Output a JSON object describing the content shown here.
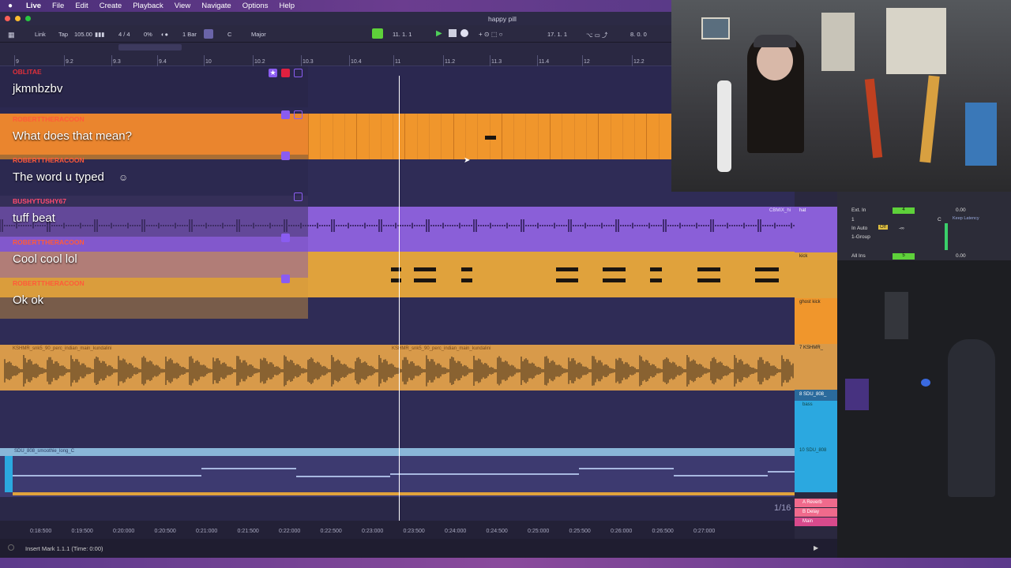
{
  "menubar": {
    "items": [
      "Live",
      "File",
      "Edit",
      "Create",
      "Playback",
      "View",
      "Navigate",
      "Options",
      "Help"
    ]
  },
  "window": {
    "title": "happy pill"
  },
  "toolbar": {
    "link": "Link",
    "tap": "Tap",
    "tempo": "105.00",
    "signature": "4 / 4",
    "groove": "0%",
    "quantize": "1 Bar",
    "key": "C",
    "scale": "Major",
    "position": "11.  1.  1",
    "loop_start": "17.  1.  1",
    "loop_length": "8.  0.  0"
  },
  "ruler": {
    "ticks": [
      "9",
      "9.2",
      "9.3",
      "9.4",
      "10",
      "10.2",
      "10.3",
      "10.4",
      "11",
      "11.2",
      "11.3",
      "11.4",
      "12",
      "12.2"
    ]
  },
  "chat": [
    {
      "user": "OBLITAE",
      "message": "jkmnbzbv",
      "color": "#e0303a"
    },
    {
      "user": "ROBERTTHERACOON",
      "message": "What does that mean?",
      "color": "#ff5a3a"
    },
    {
      "user": "ROBERTTHERACOON",
      "message": "The word u typed",
      "color": "#ff5a3a"
    },
    {
      "user": "BUSHYTUSHY67",
      "message": "tuff beat",
      "color": "#ff4b6e"
    },
    {
      "user": "ROBERTTHERACOON",
      "message": "Cool cool lol",
      "color": "#ff5a3a"
    },
    {
      "user": "ROBERTTHERACOON",
      "message": "Ok ok",
      "color": "#ff5a3a"
    }
  ],
  "clips": {
    "hat_clip_right": "CBMIX_hi",
    "audio_clip_1": "KSHMR_snk5_90_perc_indian_main_kundalini",
    "audio_clip_2": "KSHMR_snk5_90_perc_indian_main_kundalini",
    "bass_clip": "SDU_808_smoothie_long_C"
  },
  "tracks": {
    "hat": "hat",
    "kick": "kick",
    "ghost_kick": "ghost kick",
    "perc": "7 KSHMR_",
    "bass_group": "8 SDU_808_",
    "bass": "bass",
    "sdu": "10 SDU_808",
    "return_a": "A Reverb",
    "return_b": "B Delay",
    "main": "Main"
  },
  "io": {
    "ext_in": "Ext. In",
    "ch": "1",
    "in_auto": "In  Auto",
    "off": "Off",
    "group": "1-Group",
    "all_ins": "All Ins",
    "track_num_1": "4",
    "track_num_2": "5",
    "vol_1": "0.00",
    "vol_2": "0.00",
    "keep_latency": "Keep Latency",
    "sends": "-∞",
    "pan": "C"
  },
  "bottom_ruler": {
    "times": [
      "0:18:500",
      "0:19:500",
      "0:20:000",
      "0:20:500",
      "0:21:000",
      "0:21:500",
      "0:22:000",
      "0:22:500",
      "0:23:000",
      "0:23:500",
      "0:24:000",
      "0:24:500",
      "0:25:000",
      "0:25:500",
      "0:26:000",
      "0:26:500",
      "0:27:000"
    ]
  },
  "grid": "1/16",
  "status": "Insert Mark 1.1.1 (Time: 0:00)",
  "colors": {
    "menubar": "#5a3a88",
    "lane_bg": "#2f2c56",
    "midi_orange": "#f0962c",
    "hat_purple": "#8a5fd8",
    "kick_orange": "#e0a23c",
    "audio_orange": "#d89a4a",
    "bass_blue": "#2ba8e0",
    "playhead": "#ffffff"
  }
}
